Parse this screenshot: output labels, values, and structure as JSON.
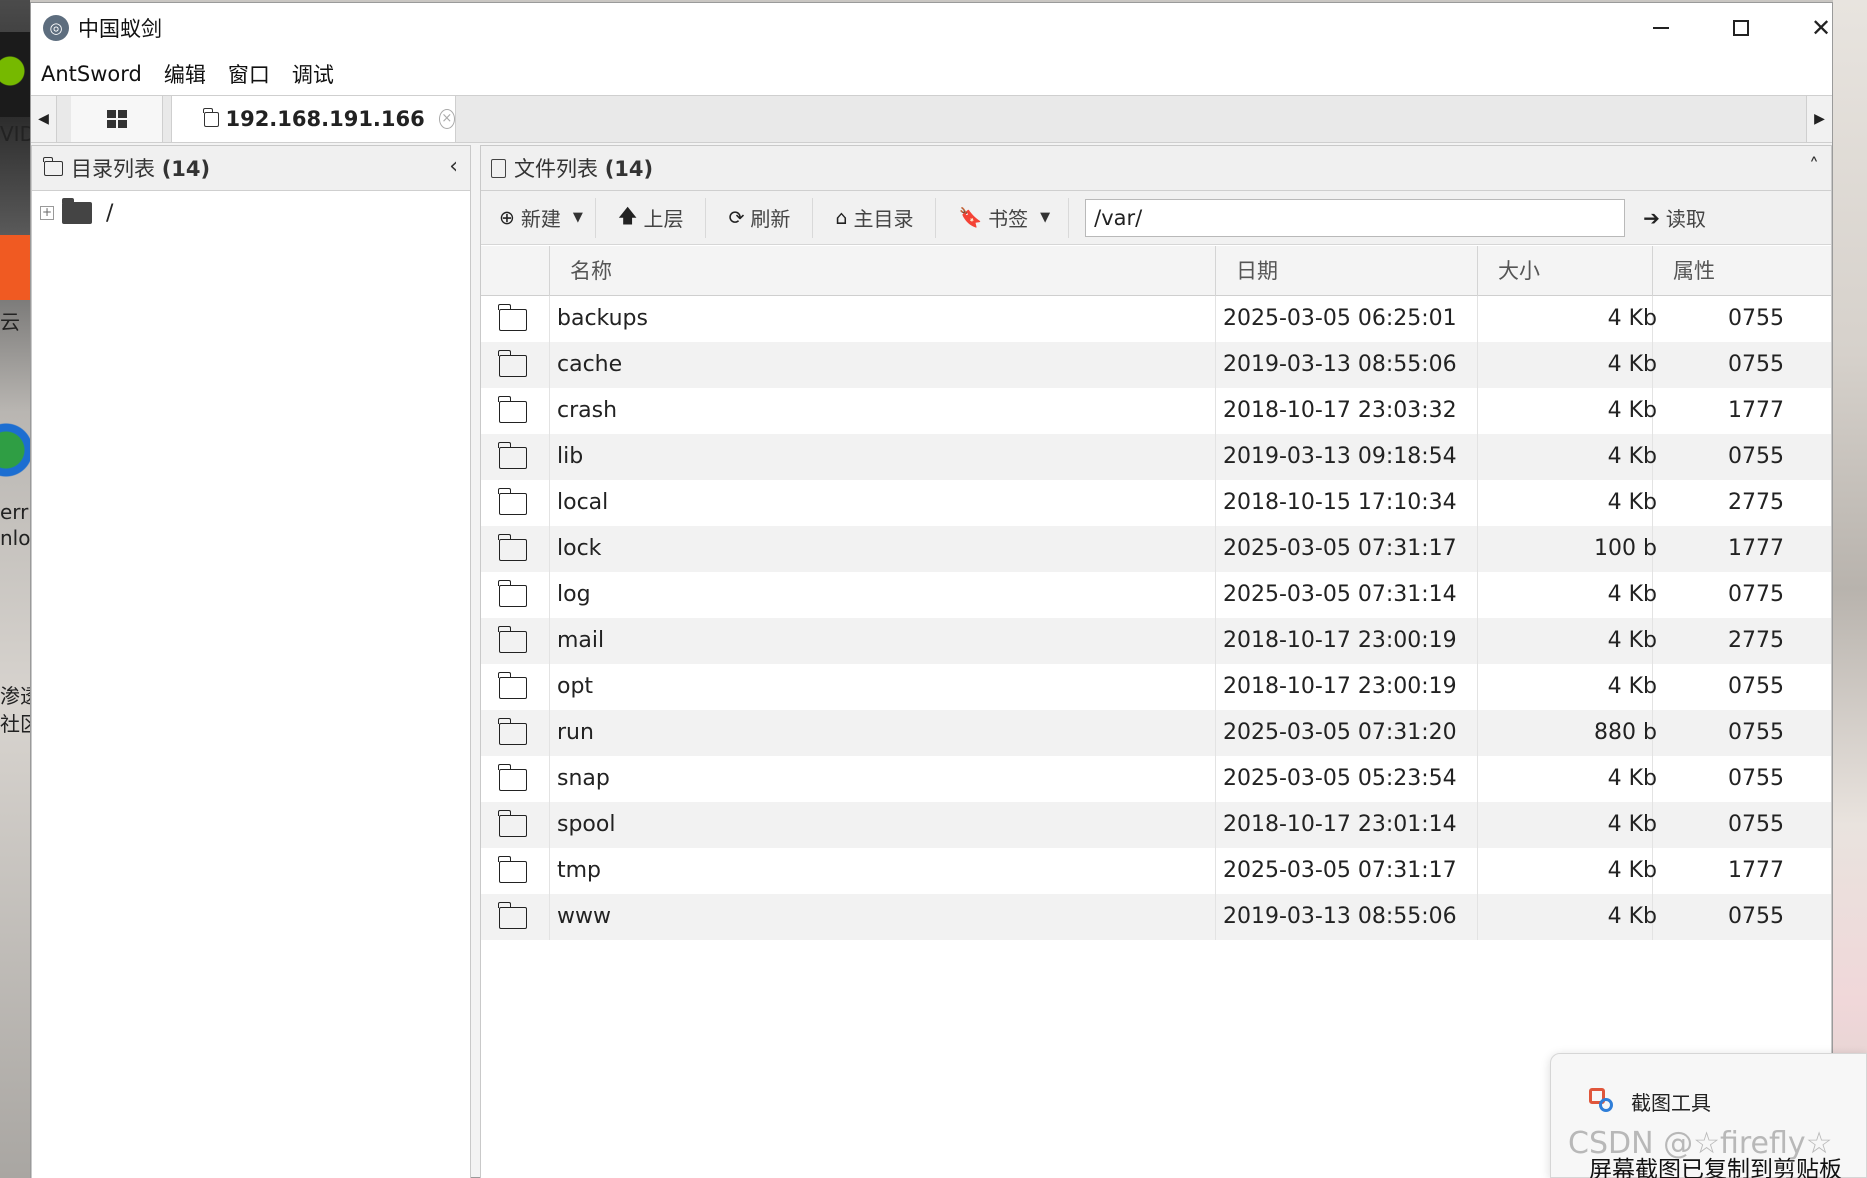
{
  "desktop": {
    "left_labels": [
      "VID",
      "云",
      "err",
      "nlo",
      "渗透",
      "社区"
    ]
  },
  "window": {
    "app_icon": "antsword-logo-icon",
    "title": "中国蚁剑",
    "controls": [
      "minimize",
      "maximize",
      "close"
    ]
  },
  "menu": {
    "items": [
      "AntSword",
      "编辑",
      "窗口",
      "调试"
    ]
  },
  "tabs": {
    "host_label": "192.168.191.166",
    "close_glyph": "×"
  },
  "dir_panel": {
    "title": "目录列表",
    "count": "(14)",
    "collapse_glyph": "‹",
    "root_toggle": "+",
    "root_label": "/"
  },
  "file_panel": {
    "title": "文件列表",
    "count": "(14)",
    "collapse_glyph": "˄",
    "toolbar": {
      "new_label": "新建",
      "up_label": "上层",
      "refresh_label": "刷新",
      "home_label": "主目录",
      "bookmark_label": "书签",
      "path_value": "/var/",
      "read_label": "读取"
    },
    "columns": [
      "名称",
      "日期",
      "大小",
      "属性"
    ],
    "rows": [
      {
        "name": "backups",
        "date": "2025-03-05 06:25:01",
        "size": "4 Kb",
        "attr": "0755"
      },
      {
        "name": "cache",
        "date": "2019-03-13 08:55:06",
        "size": "4 Kb",
        "attr": "0755"
      },
      {
        "name": "crash",
        "date": "2018-10-17 23:03:32",
        "size": "4 Kb",
        "attr": "1777"
      },
      {
        "name": "lib",
        "date": "2019-03-13 09:18:54",
        "size": "4 Kb",
        "attr": "0755"
      },
      {
        "name": "local",
        "date": "2018-10-15 17:10:34",
        "size": "4 Kb",
        "attr": "2775"
      },
      {
        "name": "lock",
        "date": "2025-03-05 07:31:17",
        "size": "100 b",
        "attr": "1777"
      },
      {
        "name": "log",
        "date": "2025-03-05 07:31:14",
        "size": "4 Kb",
        "attr": "0775"
      },
      {
        "name": "mail",
        "date": "2018-10-17 23:00:19",
        "size": "4 Kb",
        "attr": "2775"
      },
      {
        "name": "opt",
        "date": "2018-10-17 23:00:19",
        "size": "4 Kb",
        "attr": "0755"
      },
      {
        "name": "run",
        "date": "2025-03-05 07:31:20",
        "size": "880 b",
        "attr": "0755"
      },
      {
        "name": "snap",
        "date": "2025-03-05 05:23:54",
        "size": "4 Kb",
        "attr": "0755"
      },
      {
        "name": "spool",
        "date": "2018-10-17 23:01:14",
        "size": "4 Kb",
        "attr": "0755"
      },
      {
        "name": "tmp",
        "date": "2025-03-05 07:31:17",
        "size": "4 Kb",
        "attr": "1777"
      },
      {
        "name": "www",
        "date": "2019-03-13 08:55:06",
        "size": "4 Kb",
        "attr": "0755"
      }
    ]
  },
  "toast": {
    "app_name": "截图工具",
    "message": "屏幕截图已复制到剪贴板"
  },
  "watermark": "CSDN @☆firefly☆"
}
